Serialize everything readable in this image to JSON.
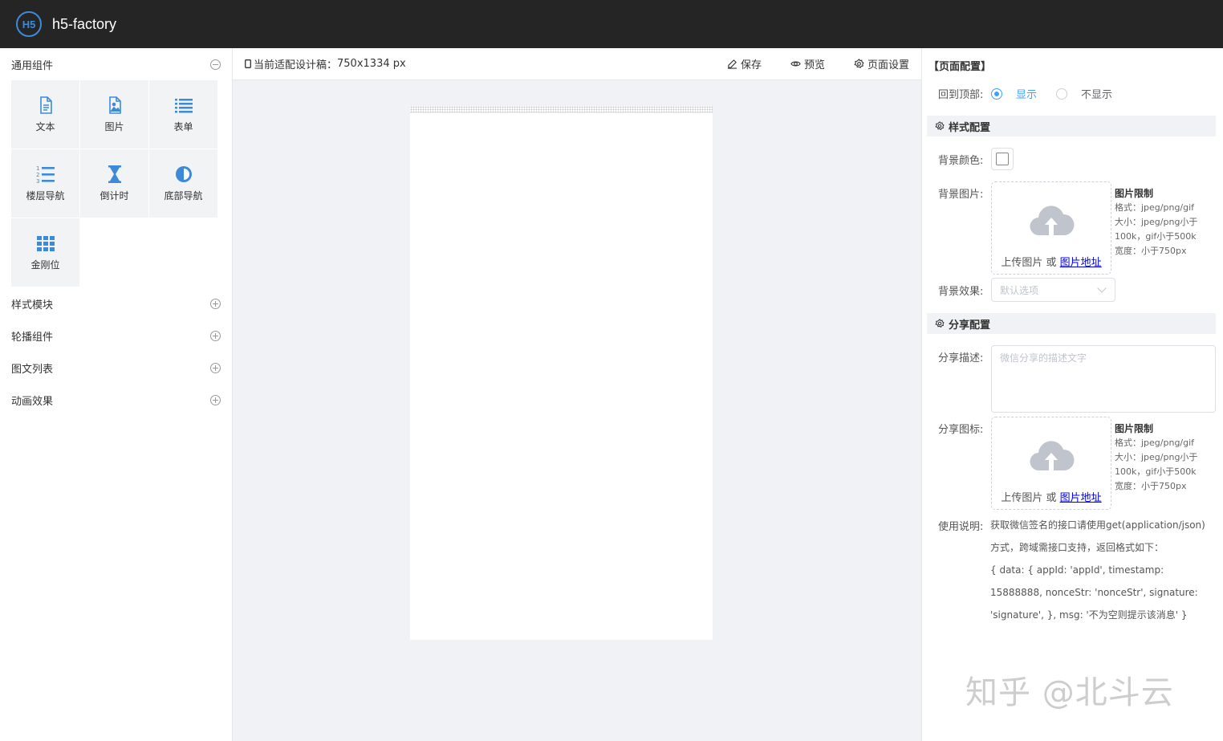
{
  "header": {
    "logo_text": "H5",
    "title": "h5-factory"
  },
  "sidebar": {
    "general_category": "通用组件",
    "components": [
      {
        "label": "文本",
        "icon": "document-icon"
      },
      {
        "label": "图片",
        "icon": "image-icon"
      },
      {
        "label": "表单",
        "icon": "list-icon"
      },
      {
        "label": "楼层导航",
        "icon": "ordered-list-icon"
      },
      {
        "label": "倒计时",
        "icon": "hourglass-icon"
      },
      {
        "label": "底部导航",
        "icon": "half-circle-icon"
      },
      {
        "label": "金刚位",
        "icon": "grid-icon"
      }
    ],
    "categories": [
      "样式模块",
      "轮播组件",
      "图文列表",
      "动画效果"
    ]
  },
  "toolbar": {
    "design_label": "当前适配设计稿：",
    "design_size": "750x1334 px",
    "save": "保存",
    "preview": "预览",
    "page_settings": "页面设置"
  },
  "panel": {
    "title": "【页面配置】",
    "back_to_top_label": "回到顶部:",
    "show_option": "显示",
    "hide_option": "不显示",
    "style_section": "样式配置",
    "bg_color_label": "背景颜色:",
    "bg_image_label": "背景图片:",
    "upload_text": "上传图片 或 ",
    "image_url_link": "图片地址",
    "limit_title": "图片限制",
    "limit_format": "格式：jpeg/png/gif",
    "limit_size": "大小：jpeg/png小于100k，gif小于500k",
    "limit_width": "宽度：小于750px",
    "bg_effect_label": "背景效果:",
    "bg_effect_placeholder": "默认选项",
    "share_section": "分享配置",
    "share_desc_label": "分享描述:",
    "share_desc_placeholder": "微信分享的描述文字",
    "share_icon_label": "分享图标:",
    "usage_label": "使用说明:",
    "usage_line1": "获取微信签名的接口请使用get(application/json)方式，跨域需接口支持，返回格式如下：",
    "usage_line2": "{ data: { appId: 'appId', timestamp: 15888888, nonceStr: 'nonceStr', signature: 'signature', }, msg: '不为空则提示该消息' }"
  },
  "watermark": "知乎 @北斗云",
  "colors": {
    "accent": "#409eff",
    "header_bg": "#252525",
    "icon_blue": "#3d8bd8"
  }
}
